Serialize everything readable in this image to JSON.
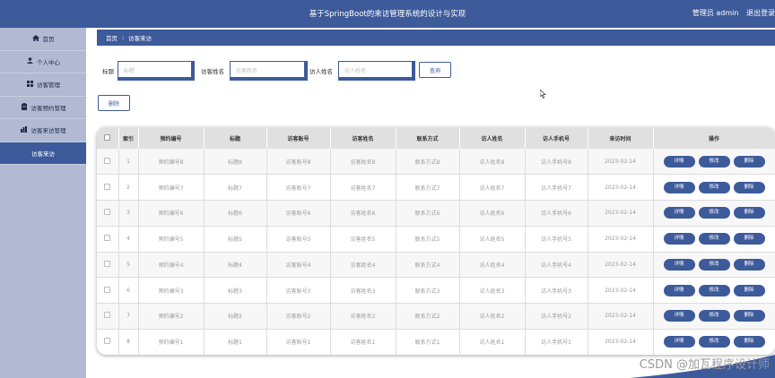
{
  "header": {
    "title": "基于SpringBoot的来访管理系统的设计与实现",
    "user": "管理员 admin",
    "logout": "退出登录"
  },
  "sidebar": {
    "items": [
      {
        "label": "首页",
        "icon": "home-icon"
      },
      {
        "label": "个人中心",
        "icon": "user-icon"
      },
      {
        "label": "访客管理",
        "icon": "grid-icon"
      },
      {
        "label": "访客预约管理",
        "icon": "clipboard-icon"
      },
      {
        "label": "访客来访管理",
        "icon": "chart-icon"
      },
      {
        "label": "访客来访",
        "icon": ""
      }
    ]
  },
  "breadcrumb": {
    "home": "首页",
    "separator": "⁝",
    "current": "访客来访"
  },
  "search": {
    "title_label": "标题",
    "title_placeholder": "标题",
    "visitor_name_label": "访客姓名",
    "visitor_name_placeholder": "访客姓名",
    "host_name_label": "访人姓名",
    "host_name_placeholder": "访人姓名",
    "query_button": "查询"
  },
  "toolbar": {
    "delete_button": "删除"
  },
  "table": {
    "columns": [
      "",
      "索引",
      "预约编号",
      "标题",
      "访客账号",
      "访客姓名",
      "联系方式",
      "访人姓名",
      "访人手机号",
      "来访时间",
      "操作"
    ],
    "rows": [
      [
        "1",
        "预约编号8",
        "标题8",
        "访客账号8",
        "访客姓名8",
        "联系方式8",
        "访人姓名8",
        "访人手机号8",
        "2023-02-14"
      ],
      [
        "2",
        "预约编号7",
        "标题7",
        "访客账号7",
        "访客姓名7",
        "联系方式7",
        "访人姓名7",
        "访人手机号7",
        "2023-02-14"
      ],
      [
        "3",
        "预约编号6",
        "标题6",
        "访客账号6",
        "访客姓名6",
        "联系方式6",
        "访人姓名6",
        "访人手机号6",
        "2023-02-14"
      ],
      [
        "4",
        "预约编号5",
        "标题5",
        "访客账号5",
        "访客姓名5",
        "联系方式5",
        "访人姓名5",
        "访人手机号5",
        "2023-02-14"
      ],
      [
        "5",
        "预约编号4",
        "标题4",
        "访客账号4",
        "访客姓名4",
        "联系方式4",
        "访人姓名4",
        "访人手机号4",
        "2023-02-14"
      ],
      [
        "6",
        "预约编号3",
        "标题3",
        "访客账号3",
        "访客姓名3",
        "联系方式3",
        "访人姓名3",
        "访人手机号3",
        "2023-02-14"
      ],
      [
        "7",
        "预约编号2",
        "标题2",
        "访客账号2",
        "访客姓名2",
        "联系方式2",
        "访人姓名2",
        "访人手机号2",
        "2023-02-14"
      ],
      [
        "8",
        "预约编号1",
        "标题1",
        "访客账号1",
        "访客姓名1",
        "联系方式1",
        "访人姓名1",
        "访人手机号1",
        "2023-02-14"
      ]
    ],
    "actions": [
      "详情",
      "修改",
      "删除"
    ]
  },
  "watermark": "CSDN @加瓦程序设计师",
  "colors": {
    "primary": "#3d5a9a",
    "sidebar": "#b1bad2",
    "header_row": "#e0e0e0"
  }
}
